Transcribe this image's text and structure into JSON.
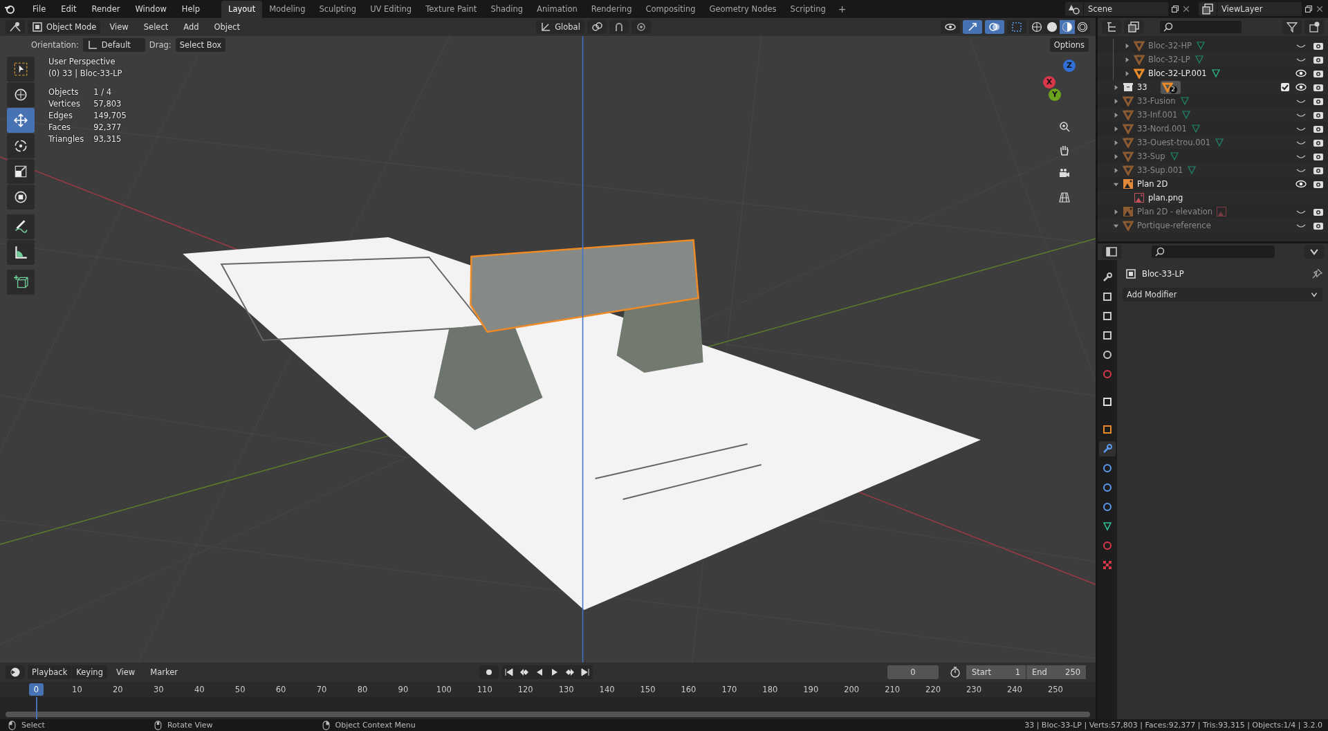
{
  "top_bar": {
    "menus": [
      "File",
      "Edit",
      "Render",
      "Window",
      "Help"
    ],
    "workspaces": [
      {
        "label": "Layout",
        "selected": true
      },
      {
        "label": "Modeling",
        "selected": false
      },
      {
        "label": "Sculpting",
        "selected": false
      },
      {
        "label": "UV Editing",
        "selected": false
      },
      {
        "label": "Texture Paint",
        "selected": false
      },
      {
        "label": "Shading",
        "selected": false
      },
      {
        "label": "Animation",
        "selected": false
      },
      {
        "label": "Rendering",
        "selected": false
      },
      {
        "label": "Compositing",
        "selected": false
      },
      {
        "label": "Geometry Nodes",
        "selected": false
      },
      {
        "label": "Scripting",
        "selected": false
      }
    ],
    "add_workspace": "+",
    "scene": "Scene",
    "view_layer": "ViewLayer"
  },
  "viewport": {
    "header": {
      "mode": "Object Mode",
      "menus": [
        "View",
        "Select",
        "Add",
        "Object"
      ],
      "transform_orientation": "Global",
      "shading": [
        {
          "kind": "wireframe",
          "selected": false
        },
        {
          "kind": "solid",
          "selected": false
        },
        {
          "kind": "material",
          "selected": true
        },
        {
          "kind": "rendered",
          "selected": false
        }
      ]
    },
    "tool_settings": {
      "orientation_label": "Orientation:",
      "orientation": "Default",
      "drag_label": "Drag:",
      "drag": "Select Box",
      "options": "Options"
    },
    "info": {
      "view": "User Perspective",
      "context": "(0) 33 | Bloc-33-LP",
      "stats": [
        {
          "label": "Objects",
          "value": "1 / 4"
        },
        {
          "label": "Vertices",
          "value": "57,803"
        },
        {
          "label": "Edges",
          "value": "149,705"
        },
        {
          "label": "Faces",
          "value": "92,377"
        },
        {
          "label": "Triangles",
          "value": "93,315"
        }
      ]
    },
    "tools": [
      {
        "kind": "select",
        "selected": false
      },
      {
        "kind": "cursor",
        "selected": false
      },
      {
        "kind": "move",
        "selected": true
      },
      {
        "kind": "rotate",
        "selected": false
      },
      {
        "kind": "scale",
        "selected": false
      },
      {
        "kind": "transform",
        "selected": false
      },
      {
        "kind": "annotate",
        "selected": false
      },
      {
        "kind": "measure",
        "selected": false
      },
      {
        "kind": "add_cube",
        "selected": false
      }
    ],
    "gizmo_axes": [
      {
        "label": "Z",
        "color": "#2f6fd6"
      },
      {
        "label": "X",
        "color": "#d9384a"
      },
      {
        "label": "Y",
        "color": "#6ba31f"
      }
    ]
  },
  "outliner": {
    "continued_children": [
      {
        "name": "Bloc-32-HP",
        "kind": "mesh",
        "mesh_data": true,
        "hidden": true,
        "expanded": false
      },
      {
        "name": "Bloc-32-LP",
        "kind": "mesh",
        "mesh_data": true,
        "hidden": true,
        "expanded": false
      },
      {
        "name": "Bloc-32-LP.001",
        "kind": "mesh",
        "mesh_data": true,
        "hidden": false,
        "expanded": false
      }
    ],
    "items": [
      {
        "name": "33",
        "kind": "collection",
        "badge": "2",
        "checked": true,
        "hidden": false,
        "expanded": false
      },
      {
        "name": "33-Fusion",
        "kind": "mesh",
        "mesh_data": true,
        "hidden": true,
        "expanded": false
      },
      {
        "name": "33-Inf.001",
        "kind": "mesh",
        "mesh_data": true,
        "hidden": true,
        "expanded": false
      },
      {
        "name": "33-Nord.001",
        "kind": "mesh",
        "mesh_data": true,
        "hidden": true,
        "expanded": false
      },
      {
        "name": "33-Ouest-trou.001",
        "kind": "mesh",
        "mesh_data": true,
        "hidden": true,
        "expanded": false
      },
      {
        "name": "33-Sup",
        "kind": "mesh",
        "mesh_data": true,
        "hidden": true,
        "expanded": false
      },
      {
        "name": "33-Sup.001",
        "kind": "mesh",
        "mesh_data": true,
        "hidden": true,
        "expanded": false
      },
      {
        "name": "Plan 2D",
        "kind": "image_empty",
        "hidden": false,
        "expanded": true,
        "children": [
          {
            "name": "plan.png",
            "kind": "image"
          }
        ]
      },
      {
        "name": "Plan 2D - elevation",
        "kind": "image_empty",
        "image_data": true,
        "hidden": true,
        "expanded": false
      },
      {
        "name": "Portique-reference",
        "kind": "mesh",
        "hidden": true,
        "expanded": true
      }
    ]
  },
  "properties": {
    "tabs": [
      {
        "kind": "tool",
        "selected": false
      },
      {
        "kind": "render",
        "selected": false
      },
      {
        "kind": "output",
        "selected": false
      },
      {
        "kind": "view_layer",
        "selected": false
      },
      {
        "kind": "scene",
        "selected": false
      },
      {
        "kind": "world",
        "selected": false
      },
      {
        "kind": "collection",
        "selected": false
      },
      {
        "kind": "object",
        "selected": false
      },
      {
        "kind": "modifiers",
        "selected": true
      },
      {
        "kind": "particles",
        "selected": false
      },
      {
        "kind": "physics",
        "selected": false
      },
      {
        "kind": "constraints",
        "selected": false
      },
      {
        "kind": "data",
        "selected": false
      },
      {
        "kind": "material",
        "selected": false
      },
      {
        "kind": "texture",
        "selected": false
      }
    ],
    "object": "Bloc-33-LP",
    "add_modifier": "Add Modifier"
  },
  "timeline": {
    "menus": [
      "Playback",
      "Keying",
      "View",
      "Marker"
    ],
    "current_frame": "0",
    "start_label": "Start",
    "start": "1",
    "end_label": "End",
    "end": "250",
    "playhead": "0",
    "ruler": [
      "10",
      "20",
      "30",
      "40",
      "50",
      "60",
      "70",
      "80",
      "90",
      "100",
      "110",
      "120",
      "130",
      "140",
      "150",
      "160",
      "170",
      "180",
      "190",
      "200",
      "210",
      "220",
      "230",
      "240",
      "250"
    ]
  },
  "status_bar": {
    "hints": [
      "Select",
      "Rotate View",
      "Object Context Menu"
    ],
    "stats": "33 | Bloc-33-LP | Verts:57,803 | Faces:92,377 | Tris:93,315 | Objects:1/4 | 3.2.0"
  }
}
